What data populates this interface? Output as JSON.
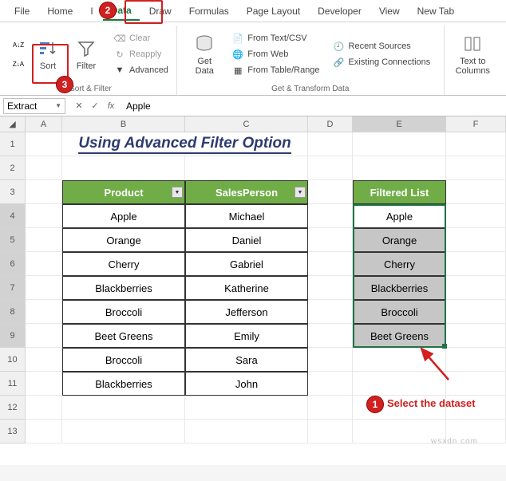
{
  "tabs": [
    "File",
    "Home",
    "I",
    "Data",
    "Draw",
    "Formulas",
    "Page Layout",
    "Developer",
    "View",
    "New Tab"
  ],
  "active_tab": 3,
  "ribbon": {
    "sort_group_label": "Sort & Filter",
    "sort_label": "Sort",
    "filter_label": "Filter",
    "clear_label": "Clear",
    "reapply_label": "Reapply",
    "advanced_label": "Advanced",
    "get_data_label": "Get\nData",
    "transform_group_label": "Get & Transform Data",
    "from_text_csv": "From Text/CSV",
    "from_web": "From Web",
    "from_table": "From Table/Range",
    "recent_sources": "Recent Sources",
    "existing_conn": "Existing Connections",
    "text_to_cols": "Text to\nColumns"
  },
  "name_box": "Extract",
  "formula_value": "Apple",
  "cols": [
    "",
    "A",
    "B",
    "C",
    "D",
    "E",
    "F"
  ],
  "title": "Using Advanced Filter Option",
  "table_headers": {
    "product": "Product",
    "sales": "SalesPerson",
    "filtered": "Filtered List"
  },
  "rows": [
    {
      "product": "Apple",
      "sales": "Michael",
      "filtered": "Apple"
    },
    {
      "product": "Orange",
      "sales": "Daniel",
      "filtered": "Orange"
    },
    {
      "product": "Cherry",
      "sales": "Gabriel",
      "filtered": "Cherry"
    },
    {
      "product": "Blackberries",
      "sales": "Katherine",
      "filtered": "Blackberries"
    },
    {
      "product": "Broccoli",
      "sales": "Jefferson",
      "filtered": "Broccoli"
    },
    {
      "product": "Beet Greens",
      "sales": "Emily",
      "filtered": "Beet Greens"
    },
    {
      "product": "Broccoli",
      "sales": "Sara",
      "filtered": ""
    },
    {
      "product": "Blackberries",
      "sales": "John",
      "filtered": ""
    }
  ],
  "steps": {
    "1": "1",
    "2": "2",
    "3": "3",
    "label": "Select the dataset"
  },
  "watermark": "wsxdn.com"
}
